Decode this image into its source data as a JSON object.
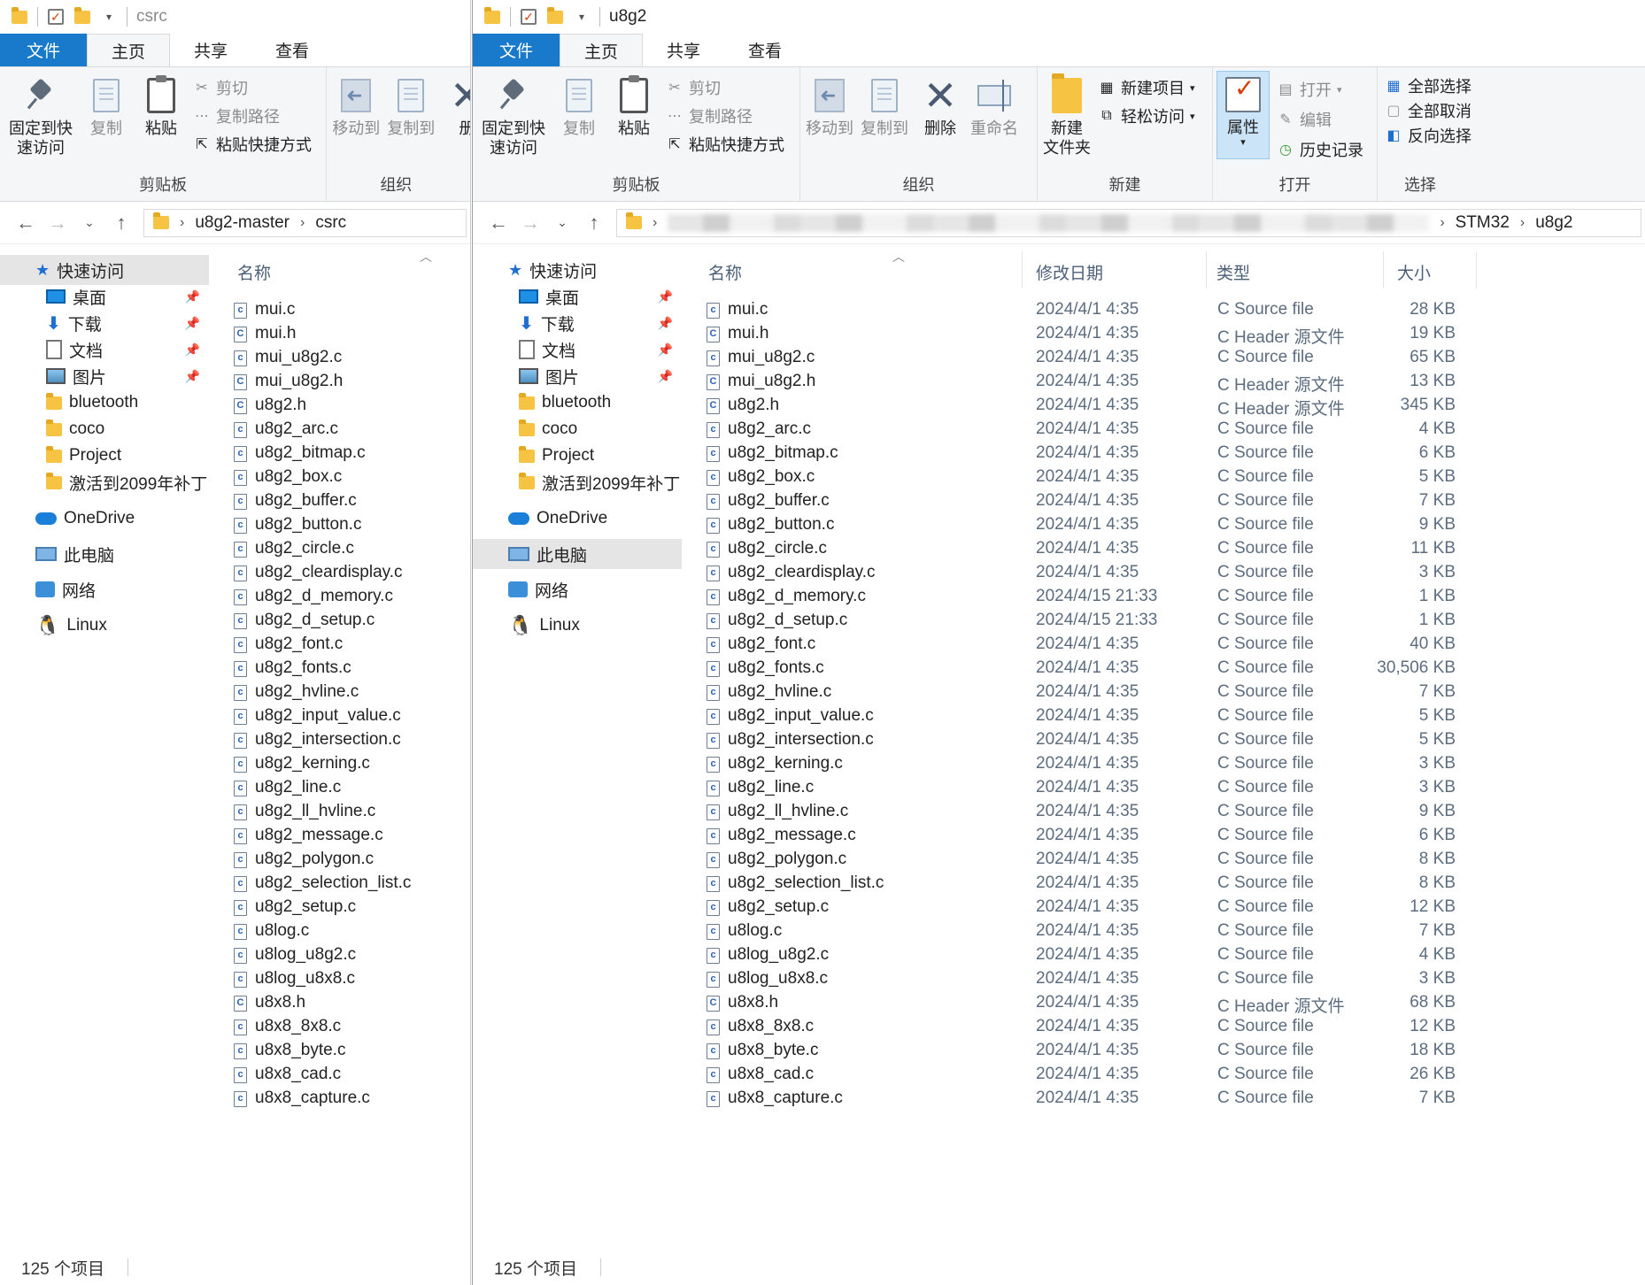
{
  "left": {
    "title": "csrc",
    "menu": [
      "文件",
      "主页",
      "共享",
      "查看"
    ],
    "ribbon": {
      "pin": "固定到快\n速访问",
      "copy": "复制",
      "paste": "粘贴",
      "cut": "剪切",
      "copy_path": "复制路径",
      "paste_shortcut": "粘贴快捷方式",
      "move_to": "移动到",
      "copy_to": "复制到",
      "delete_partial": "册",
      "clipboard_label": "剪贴板",
      "organize_label": "组织"
    },
    "breadcrumbs": [
      "u8g2-master",
      "csrc"
    ],
    "col_name": "名称",
    "status": "125 个项目"
  },
  "right": {
    "title": "u8g2",
    "menu": [
      "文件",
      "主页",
      "共享",
      "查看"
    ],
    "ribbon": {
      "pin": "固定到快\n速访问",
      "copy": "复制",
      "paste": "粘贴",
      "cut": "剪切",
      "copy_path": "复制路径",
      "paste_shortcut": "粘贴快捷方式",
      "move_to": "移动到",
      "copy_to": "复制到",
      "delete": "删除",
      "rename": "重命名",
      "new_folder": "新建\n文件夹",
      "new_item": "新建项目",
      "easy_access": "轻松访问",
      "properties": "属性",
      "open": "打开",
      "edit": "编辑",
      "history": "历史记录",
      "select_all": "全部选择",
      "select_none": "全部取消",
      "invert_select": "反向选择",
      "clipboard_label": "剪贴板",
      "organize_label": "组织",
      "new_label": "新建",
      "open_label": "打开",
      "select_label": "选择"
    },
    "breadcrumbs": [
      "STM32",
      "u8g2"
    ],
    "columns": {
      "name": "名称",
      "date": "修改日期",
      "type": "类型",
      "size": "大小"
    },
    "status": "125 个项目"
  },
  "nav": {
    "quick_access": "快速访问",
    "desktop": "桌面",
    "downloads": "下载",
    "documents": "文档",
    "pictures": "图片",
    "f1": "bluetooth",
    "f2": "coco",
    "f3": "Project",
    "f4": "激活到2099年补丁",
    "onedrive": "OneDrive",
    "this_pc": "此电脑",
    "network": "网络",
    "linux": "Linux"
  },
  "files": [
    {
      "name": "mui.c",
      "date": "2024/4/1 4:35",
      "type": "C Source file",
      "size": "28 KB",
      "kind": "c"
    },
    {
      "name": "mui.h",
      "date": "2024/4/1 4:35",
      "type": "C Header 源文件",
      "size": "19 KB",
      "kind": "h"
    },
    {
      "name": "mui_u8g2.c",
      "date": "2024/4/1 4:35",
      "type": "C Source file",
      "size": "65 KB",
      "kind": "c"
    },
    {
      "name": "mui_u8g2.h",
      "date": "2024/4/1 4:35",
      "type": "C Header 源文件",
      "size": "13 KB",
      "kind": "h"
    },
    {
      "name": "u8g2.h",
      "date": "2024/4/1 4:35",
      "type": "C Header 源文件",
      "size": "345 KB",
      "kind": "h"
    },
    {
      "name": "u8g2_arc.c",
      "date": "2024/4/1 4:35",
      "type": "C Source file",
      "size": "4 KB",
      "kind": "c"
    },
    {
      "name": "u8g2_bitmap.c",
      "date": "2024/4/1 4:35",
      "type": "C Source file",
      "size": "6 KB",
      "kind": "c"
    },
    {
      "name": "u8g2_box.c",
      "date": "2024/4/1 4:35",
      "type": "C Source file",
      "size": "5 KB",
      "kind": "c"
    },
    {
      "name": "u8g2_buffer.c",
      "date": "2024/4/1 4:35",
      "type": "C Source file",
      "size": "7 KB",
      "kind": "c"
    },
    {
      "name": "u8g2_button.c",
      "date": "2024/4/1 4:35",
      "type": "C Source file",
      "size": "9 KB",
      "kind": "c"
    },
    {
      "name": "u8g2_circle.c",
      "date": "2024/4/1 4:35",
      "type": "C Source file",
      "size": "11 KB",
      "kind": "c"
    },
    {
      "name": "u8g2_cleardisplay.c",
      "date": "2024/4/1 4:35",
      "type": "C Source file",
      "size": "3 KB",
      "kind": "c"
    },
    {
      "name": "u8g2_d_memory.c",
      "date": "2024/4/15 21:33",
      "type": "C Source file",
      "size": "1 KB",
      "kind": "c"
    },
    {
      "name": "u8g2_d_setup.c",
      "date": "2024/4/15 21:33",
      "type": "C Source file",
      "size": "1 KB",
      "kind": "c"
    },
    {
      "name": "u8g2_font.c",
      "date": "2024/4/1 4:35",
      "type": "C Source file",
      "size": "40 KB",
      "kind": "c"
    },
    {
      "name": "u8g2_fonts.c",
      "date": "2024/4/1 4:35",
      "type": "C Source file",
      "size": "30,506 KB",
      "kind": "c"
    },
    {
      "name": "u8g2_hvline.c",
      "date": "2024/4/1 4:35",
      "type": "C Source file",
      "size": "7 KB",
      "kind": "c"
    },
    {
      "name": "u8g2_input_value.c",
      "date": "2024/4/1 4:35",
      "type": "C Source file",
      "size": "5 KB",
      "kind": "c"
    },
    {
      "name": "u8g2_intersection.c",
      "date": "2024/4/1 4:35",
      "type": "C Source file",
      "size": "5 KB",
      "kind": "c"
    },
    {
      "name": "u8g2_kerning.c",
      "date": "2024/4/1 4:35",
      "type": "C Source file",
      "size": "3 KB",
      "kind": "c"
    },
    {
      "name": "u8g2_line.c",
      "date": "2024/4/1 4:35",
      "type": "C Source file",
      "size": "3 KB",
      "kind": "c"
    },
    {
      "name": "u8g2_ll_hvline.c",
      "date": "2024/4/1 4:35",
      "type": "C Source file",
      "size": "9 KB",
      "kind": "c"
    },
    {
      "name": "u8g2_message.c",
      "date": "2024/4/1 4:35",
      "type": "C Source file",
      "size": "6 KB",
      "kind": "c"
    },
    {
      "name": "u8g2_polygon.c",
      "date": "2024/4/1 4:35",
      "type": "C Source file",
      "size": "8 KB",
      "kind": "c"
    },
    {
      "name": "u8g2_selection_list.c",
      "date": "2024/4/1 4:35",
      "type": "C Source file",
      "size": "8 KB",
      "kind": "c"
    },
    {
      "name": "u8g2_setup.c",
      "date": "2024/4/1 4:35",
      "type": "C Source file",
      "size": "12 KB",
      "kind": "c"
    },
    {
      "name": "u8log.c",
      "date": "2024/4/1 4:35",
      "type": "C Source file",
      "size": "7 KB",
      "kind": "c"
    },
    {
      "name": "u8log_u8g2.c",
      "date": "2024/4/1 4:35",
      "type": "C Source file",
      "size": "4 KB",
      "kind": "c"
    },
    {
      "name": "u8log_u8x8.c",
      "date": "2024/4/1 4:35",
      "type": "C Source file",
      "size": "3 KB",
      "kind": "c"
    },
    {
      "name": "u8x8.h",
      "date": "2024/4/1 4:35",
      "type": "C Header 源文件",
      "size": "68 KB",
      "kind": "h"
    },
    {
      "name": "u8x8_8x8.c",
      "date": "2024/4/1 4:35",
      "type": "C Source file",
      "size": "12 KB",
      "kind": "c"
    },
    {
      "name": "u8x8_byte.c",
      "date": "2024/4/1 4:35",
      "type": "C Source file",
      "size": "18 KB",
      "kind": "c"
    },
    {
      "name": "u8x8_cad.c",
      "date": "2024/4/1 4:35",
      "type": "C Source file",
      "size": "26 KB",
      "kind": "c"
    },
    {
      "name": "u8x8_capture.c",
      "date": "2024/4/1 4:35",
      "type": "C Source file",
      "size": "7 KB",
      "kind": "c"
    }
  ]
}
